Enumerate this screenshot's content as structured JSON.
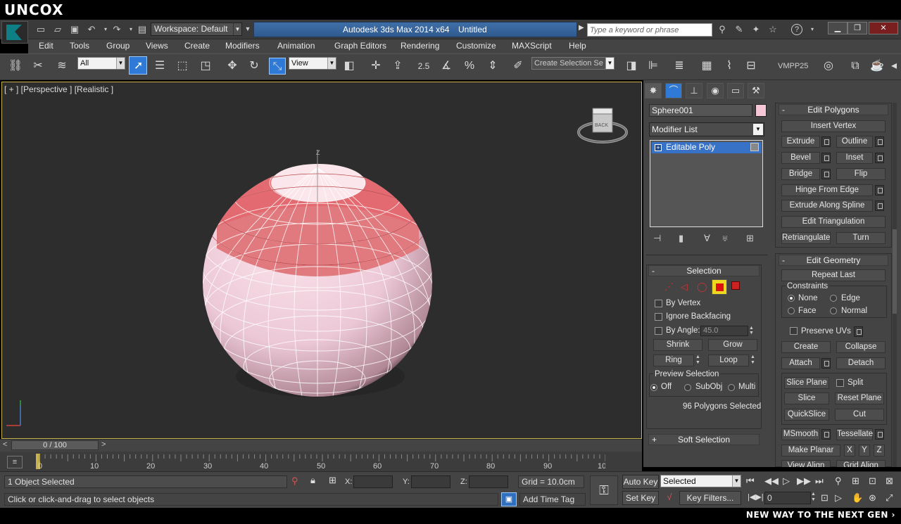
{
  "watermark": {
    "logo": "UNCOX",
    "tagline": "NEW WAY TO THE NEXT GEN ›"
  },
  "titlebar": {
    "workspace": "Workspace: Default",
    "app_title": "Autodesk 3ds Max  2014 x64",
    "doc_title": "Untitled",
    "search_placeholder": "Type a keyword or phrase",
    "help": "?"
  },
  "menu": [
    "Edit",
    "Tools",
    "Group",
    "Views",
    "Create",
    "Modifiers",
    "Animation",
    "Graph Editors",
    "Rendering",
    "Customize",
    "MAXScript",
    "Help"
  ],
  "toolbar": {
    "filter": "All",
    "ref_coord": "View",
    "snap_value": "2.5",
    "selection_set": "Create Selection Se",
    "plugin": "VMPP25"
  },
  "viewport": {
    "label": "[ + ] [Perspective ] [Realistic ]",
    "viewcube_face": "BACK",
    "gizmo_top": "Z"
  },
  "timeline": {
    "slider": "0 / 100",
    "prev": "<",
    "next": ">",
    "ticks": [
      "0",
      "10",
      "20",
      "30",
      "40",
      "50",
      "60",
      "70",
      "80",
      "90",
      "100"
    ]
  },
  "status": {
    "objects_selected": "1 Object Selected",
    "prompt": "Click or click-and-drag to select objects",
    "x_label": "X:",
    "y_label": "Y:",
    "z_label": "Z:",
    "grid": "Grid = 10.0cm",
    "add_time_tag": "Add Time Tag",
    "auto_key": "Auto Key",
    "set_key": "Set Key",
    "key_mode": "Selected",
    "key_filters": "Key Filters...",
    "frame": "0"
  },
  "command_panel": {
    "object_name": "Sphere001",
    "object_color": "#f4c6d6",
    "modifier_list": "Modifier List",
    "stack_item": "Editable Poly",
    "selection": {
      "title": "Selection",
      "by_vertex": "By Vertex",
      "ignore_backfacing": "Ignore Backfacing",
      "by_angle": "By Angle:",
      "angle_value": "45.0",
      "shrink": "Shrink",
      "grow": "Grow",
      "ring": "Ring",
      "loop": "Loop",
      "preview_title": "Preview Selection",
      "preview_off": "Off",
      "preview_subobj": "SubObj",
      "preview_multi": "Multi",
      "count": "96 Polygons Selected"
    },
    "soft_selection": "Soft Selection",
    "edit_polygons": {
      "title": "Edit Polygons",
      "insert_vertex": "Insert Vertex",
      "extrude": "Extrude",
      "outline": "Outline",
      "bevel": "Bevel",
      "inset": "Inset",
      "bridge": "Bridge",
      "flip": "Flip",
      "hinge": "Hinge From Edge",
      "extrude_spline": "Extrude Along Spline",
      "edit_tri": "Edit Triangulation",
      "retriangulate": "Retriangulate",
      "turn": "Turn"
    },
    "edit_geometry": {
      "title": "Edit Geometry",
      "repeat_last": "Repeat Last",
      "constraints": "Constraints",
      "none": "None",
      "edge": "Edge",
      "face": "Face",
      "normal": "Normal",
      "preserve_uvs": "Preserve UVs",
      "create": "Create",
      "collapse": "Collapse",
      "attach": "Attach",
      "detach": "Detach",
      "slice_plane": "Slice Plane",
      "split": "Split",
      "slice": "Slice",
      "reset_plane": "Reset Plane",
      "quickslice": "QuickSlice",
      "cut": "Cut",
      "msmooth": "MSmooth",
      "tessellate": "Tessellate",
      "make_planar": "Make Planar",
      "x": "X",
      "y": "Y",
      "z": "Z",
      "view_align": "View Align",
      "grid_align": "Grid Align"
    }
  }
}
